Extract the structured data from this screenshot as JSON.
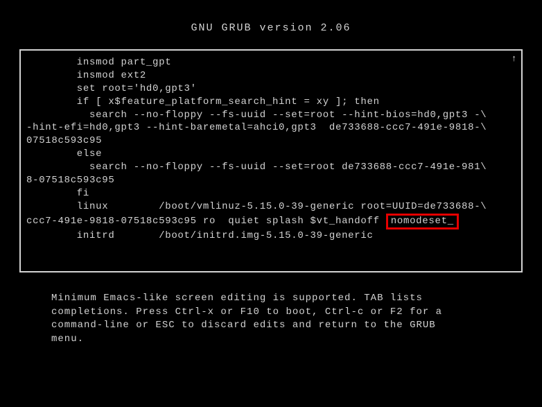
{
  "title": "GNU GRUB  version 2.06",
  "scroll_arrow": "↑",
  "editor": {
    "line1": "        insmod part_gpt",
    "line2": "        insmod ext2",
    "line3": "        set root='hd0,gpt3'",
    "line4": "        if [ x$feature_platform_search_hint = xy ]; then",
    "line5": "          search --no-floppy --fs-uuid --set=root --hint-bios=hd0,gpt3 -\\",
    "line6": "-hint-efi=hd0,gpt3 --hint-baremetal=ahci0,gpt3  de733688-ccc7-491e-9818-\\",
    "line7": "07518c593c95",
    "line8": "        else",
    "line9": "          search --no-floppy --fs-uuid --set=root de733688-ccc7-491e-981\\",
    "line10": "8-07518c593c95",
    "line11": "        fi",
    "line12": "        linux        /boot/vmlinuz-5.15.0-39-generic root=UUID=de733688-\\",
    "line13a": "ccc7-491e-9818-07518c593c95 ro  quiet splash $vt_handoff ",
    "line13b": "nomodeset_",
    "line14": "        initrd       /boot/initrd.img-5.15.0-39-generic"
  },
  "help": {
    "line1": "Minimum Emacs-like screen editing is supported. TAB lists",
    "line2": "completions. Press Ctrl-x or F10 to boot, Ctrl-c or F2 for a",
    "line3": "command-line or ESC to discard edits and return to the GRUB",
    "line4": "menu."
  }
}
